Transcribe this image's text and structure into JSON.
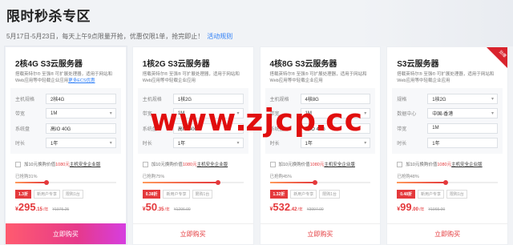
{
  "header": {
    "title": "限时秒杀专区",
    "subtitle": "5月17日-5月23日，每天上午9点限量开抢，优惠仅限1单，抢完即止！",
    "rules_link": "活动规则"
  },
  "cards": [
    {
      "title": "2核4G S3云服务器",
      "desc": "搭载英特尔® 至强® 可扩展处理器，适用于网站和Web应用等中轻载企业应用",
      "desc_link": "更多ECS优惠",
      "specs": [
        {
          "label": "主机规格",
          "value": "2核4G",
          "dropdown": false
        },
        {
          "label": "带宽",
          "value": "1M",
          "dropdown": true
        },
        {
          "label": "系统盘",
          "value": "高IO 40G",
          "dropdown": false
        },
        {
          "label": "时长",
          "value": "1年",
          "dropdown": true
        }
      ],
      "promo": {
        "pre": "加10元换购价值",
        "amount": "1080元",
        "link": "主机安全企业版"
      },
      "sold": "已抢购31%",
      "sold_fraction": 0.31,
      "discount": "1.3折",
      "tags": [
        "新用户专享",
        "限购1台"
      ],
      "price_yen": "¥",
      "price_int": "295",
      "price_dec": ".15",
      "price_unit": "/年",
      "price_orig": "¥1975.25",
      "buy_label": "立即购买",
      "active": true,
      "ribbon": ""
    },
    {
      "title": "1核2G S3云服务器",
      "desc": "搭载英特尔® 至强® 可扩展处理器，适用于网站和Web应用等中轻载企业应用",
      "desc_link": "",
      "specs": [
        {
          "label": "主机规格",
          "value": "1核2G",
          "dropdown": false
        },
        {
          "label": "带宽",
          "value": "1M",
          "dropdown": true
        },
        {
          "label": "系统盘",
          "value": "高IO 40G",
          "dropdown": false
        },
        {
          "label": "时长",
          "value": "1年",
          "dropdown": true
        }
      ],
      "promo": {
        "pre": "加10元换购价值",
        "amount": "1080元",
        "link": "主机安全企业版"
      },
      "sold": "已抢购75%",
      "sold_fraction": 0.75,
      "discount": "0.38折",
      "tags": [
        "新用户专享",
        "限购1台"
      ],
      "price_yen": "¥",
      "price_int": "50",
      "price_dec": ".35",
      "price_unit": "/年",
      "price_orig": "¥1296.00",
      "buy_label": "立即购买",
      "active": false,
      "ribbon": ""
    },
    {
      "title": "4核8G S3云服务器",
      "desc": "搭载英特尔® 至强® 可扩展处理器，适用于网站和Web应用等中轻载企业应用",
      "desc_link": "",
      "specs": [
        {
          "label": "主机规格",
          "value": "4核8G",
          "dropdown": false
        },
        {
          "label": "带宽",
          "value": "1M",
          "dropdown": true
        },
        {
          "label": "系统盘",
          "value": "高IO 40G",
          "dropdown": false
        },
        {
          "label": "时长",
          "value": "1年",
          "dropdown": true
        }
      ],
      "promo": {
        "pre": "加10元换购价值",
        "amount": "1080元",
        "link": "主机安全企业版"
      },
      "sold": "已抢购45%",
      "sold_fraction": 0.45,
      "discount": "1.32折",
      "tags": [
        "新用户专享",
        "限购1台"
      ],
      "price_yen": "¥",
      "price_int": "532",
      "price_dec": ".42",
      "price_unit": "/年",
      "price_orig": "¥3997.00",
      "buy_label": "立即购买",
      "active": false,
      "ribbon": ""
    },
    {
      "title": "S3云服务器",
      "desc": "搭载英特尔® 至强® 可扩展处理器，适用于网站和Web应用等中轻载企业应用",
      "desc_link": "",
      "specs": [
        {
          "label": "规格",
          "value": "1核2G",
          "dropdown": true
        },
        {
          "label": "数据中心",
          "value": "中国-香港",
          "dropdown": true
        },
        {
          "label": "带宽",
          "value": "1M",
          "dropdown": false
        },
        {
          "label": "时长",
          "value": "1年",
          "dropdown": false
        }
      ],
      "promo": {
        "pre": "加10元换购价值",
        "amount": "1080元",
        "link": "主机安全企业版"
      },
      "sold": "已抢购48%",
      "sold_fraction": 0.48,
      "discount": "0.48折",
      "tags": [
        "新用户专享",
        "限购1台"
      ],
      "price_yen": "¥",
      "price_int": "99",
      "price_dec": ".00",
      "price_unit": "/年",
      "price_orig": "¥1965.00",
      "buy_label": "立即购买",
      "active": false,
      "ribbon": "劲爆"
    }
  ],
  "watermark": {
    "text_a": "www",
    "text_b": "zjcp",
    "text_c": "cc"
  },
  "colors": {
    "accent": "#e4393c",
    "link": "#2d7ef7",
    "watermark": "#e10e0e"
  }
}
